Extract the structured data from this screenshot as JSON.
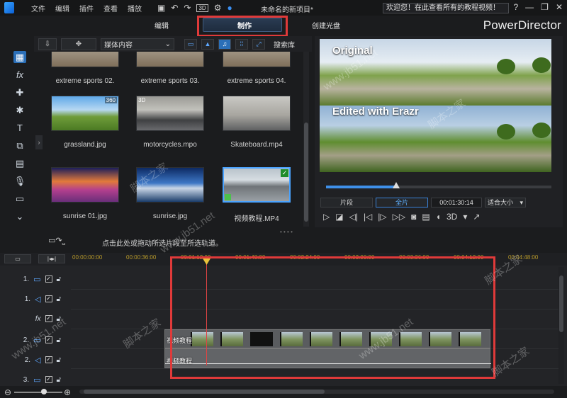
{
  "titlebar": {
    "menu": [
      "文件",
      "编辑",
      "插件",
      "查看",
      "播放"
    ],
    "project_title": "未命名的新项目*",
    "welcome_text": "欢迎您！在此查看所有的教程视频！",
    "badge_3d": "3D",
    "controls": [
      "?",
      "—",
      "❐",
      "✕"
    ]
  },
  "modes": {
    "edit": "编辑",
    "make": "制作",
    "disc": "创建光盘"
  },
  "brand": "PowerDirector",
  "library": {
    "select_value": "媒体内容",
    "search_label": "搜索库",
    "items": [
      {
        "caption": "extreme sports 02.",
        "badge": ""
      },
      {
        "caption": "extreme sports 03.",
        "badge": ""
      },
      {
        "caption": "extreme sports 04.",
        "badge": ""
      },
      {
        "caption": "grassland.jpg",
        "badge": "360"
      },
      {
        "caption": "motorcycles.mpo",
        "badge": "3D"
      },
      {
        "caption": "Skateboard.mp4",
        "badge": ""
      },
      {
        "caption": "sunrise 01.jpg",
        "badge": ""
      },
      {
        "caption": "sunrise.jpg",
        "badge": ""
      },
      {
        "caption": "视频教程.MP4",
        "badge": ""
      }
    ]
  },
  "preview": {
    "label_top": "Original",
    "label_bottom": "Edited with Erazr",
    "progress": 0.31,
    "seg_clip": "片段",
    "seg_full": "全片",
    "timecode": "00:01:30:14",
    "fit": "适合大小",
    "transport_3d": "3D"
  },
  "hint": {
    "text": "点击此处或拖动所选片段至所选轨道。"
  },
  "timeline": {
    "ruler": [
      "00:00:00:00",
      "00:00:36:00",
      "00:01:12:00",
      "00:01:48:00",
      "00:02:24:00",
      "00:03:00:00",
      "00:03:36:00",
      "00:04:12:00",
      "00:04:48:00"
    ],
    "tracks": [
      {
        "label": "1.",
        "type": "video"
      },
      {
        "label": "1.",
        "type": "audio"
      },
      {
        "label": "",
        "type": "fx"
      },
      {
        "label": "2.",
        "type": "video"
      },
      {
        "label": "2.",
        "type": "audio"
      },
      {
        "label": "3.",
        "type": "video"
      }
    ],
    "clip_video_label": "视频教程",
    "clip_audio_label": "视频教程"
  },
  "colors": {
    "accent": "#2b6fb8",
    "highlight_box": "#e03a3a",
    "playhead": "#dd4444"
  },
  "watermarks": [
    "脚本之家",
    "www.jb51.net"
  ]
}
